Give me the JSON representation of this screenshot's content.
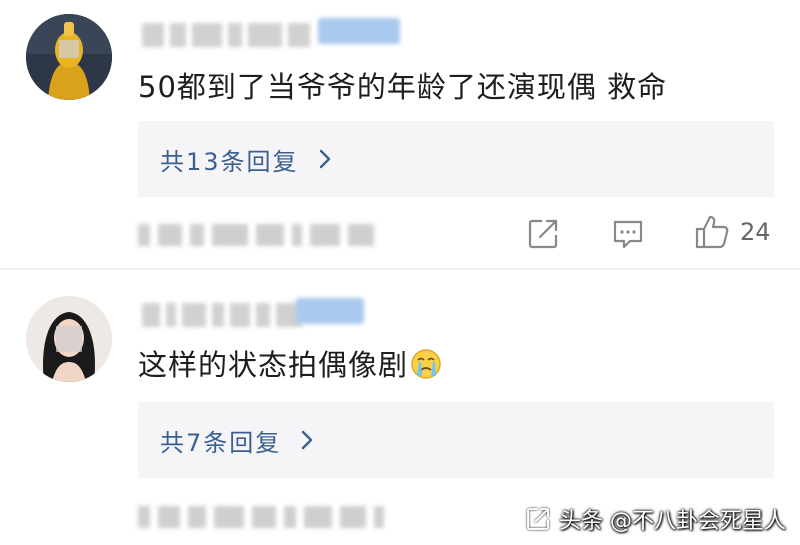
{
  "comments": [
    {
      "avatar_icon": "avatar-gold-figure",
      "text": "50都到了当爷爷的年龄了还演现偶 救命",
      "reply_label": "共13条回复",
      "like_count": "24"
    },
    {
      "avatar_icon": "avatar-long-hair",
      "text": "这样的状态拍偶像剧",
      "emoji_icon": "crying-face-emoji",
      "reply_label": "共7条回复"
    }
  ],
  "icons": {
    "share": "share-icon",
    "comment": "comment-icon",
    "like": "thumbs-up-icon",
    "chevron": "chevron-right-icon"
  },
  "watermark": {
    "text": "头条 @不八卦会死星人"
  },
  "colors": {
    "reply_link": "#3a5f90",
    "reply_bg": "#f5f5f7",
    "icon_gray": "#888888"
  }
}
